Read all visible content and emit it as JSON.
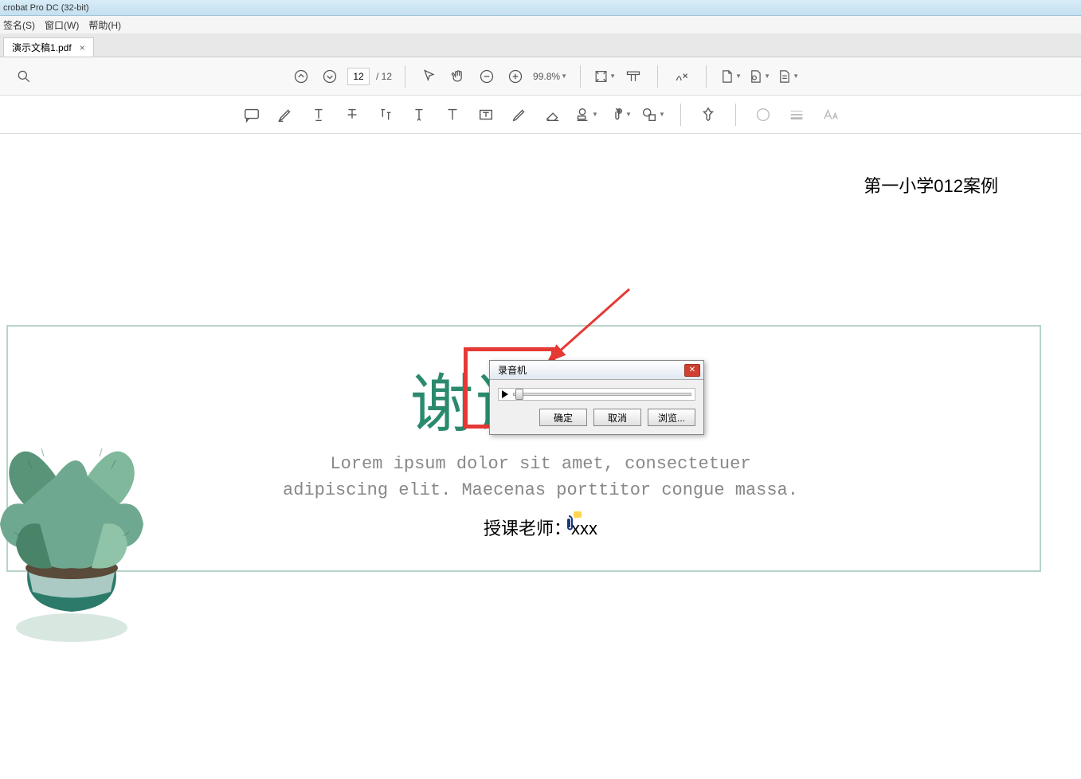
{
  "app": {
    "title": "crobat Pro DC (32-bit)"
  },
  "menu": {
    "sign": "签名(S)",
    "window": "窗口(W)",
    "help": "帮助(H)"
  },
  "tab": {
    "filename": "演示文稿1.pdf"
  },
  "toolbar": {
    "page_current": "12",
    "page_total_prefix": "/ ",
    "page_total": "12",
    "zoom": "99.8%"
  },
  "document": {
    "header": "第一小学012案例",
    "title": "谢谢观赏",
    "lorem": "Lorem ipsum dolor sit amet, consectetuer\nadipiscing elit. Maecenas porttitor congue massa.",
    "teacher": "授课老师：xxx"
  },
  "dialog": {
    "title": "录音机",
    "ok": "确定",
    "cancel": "取消",
    "browse": "浏览..."
  }
}
